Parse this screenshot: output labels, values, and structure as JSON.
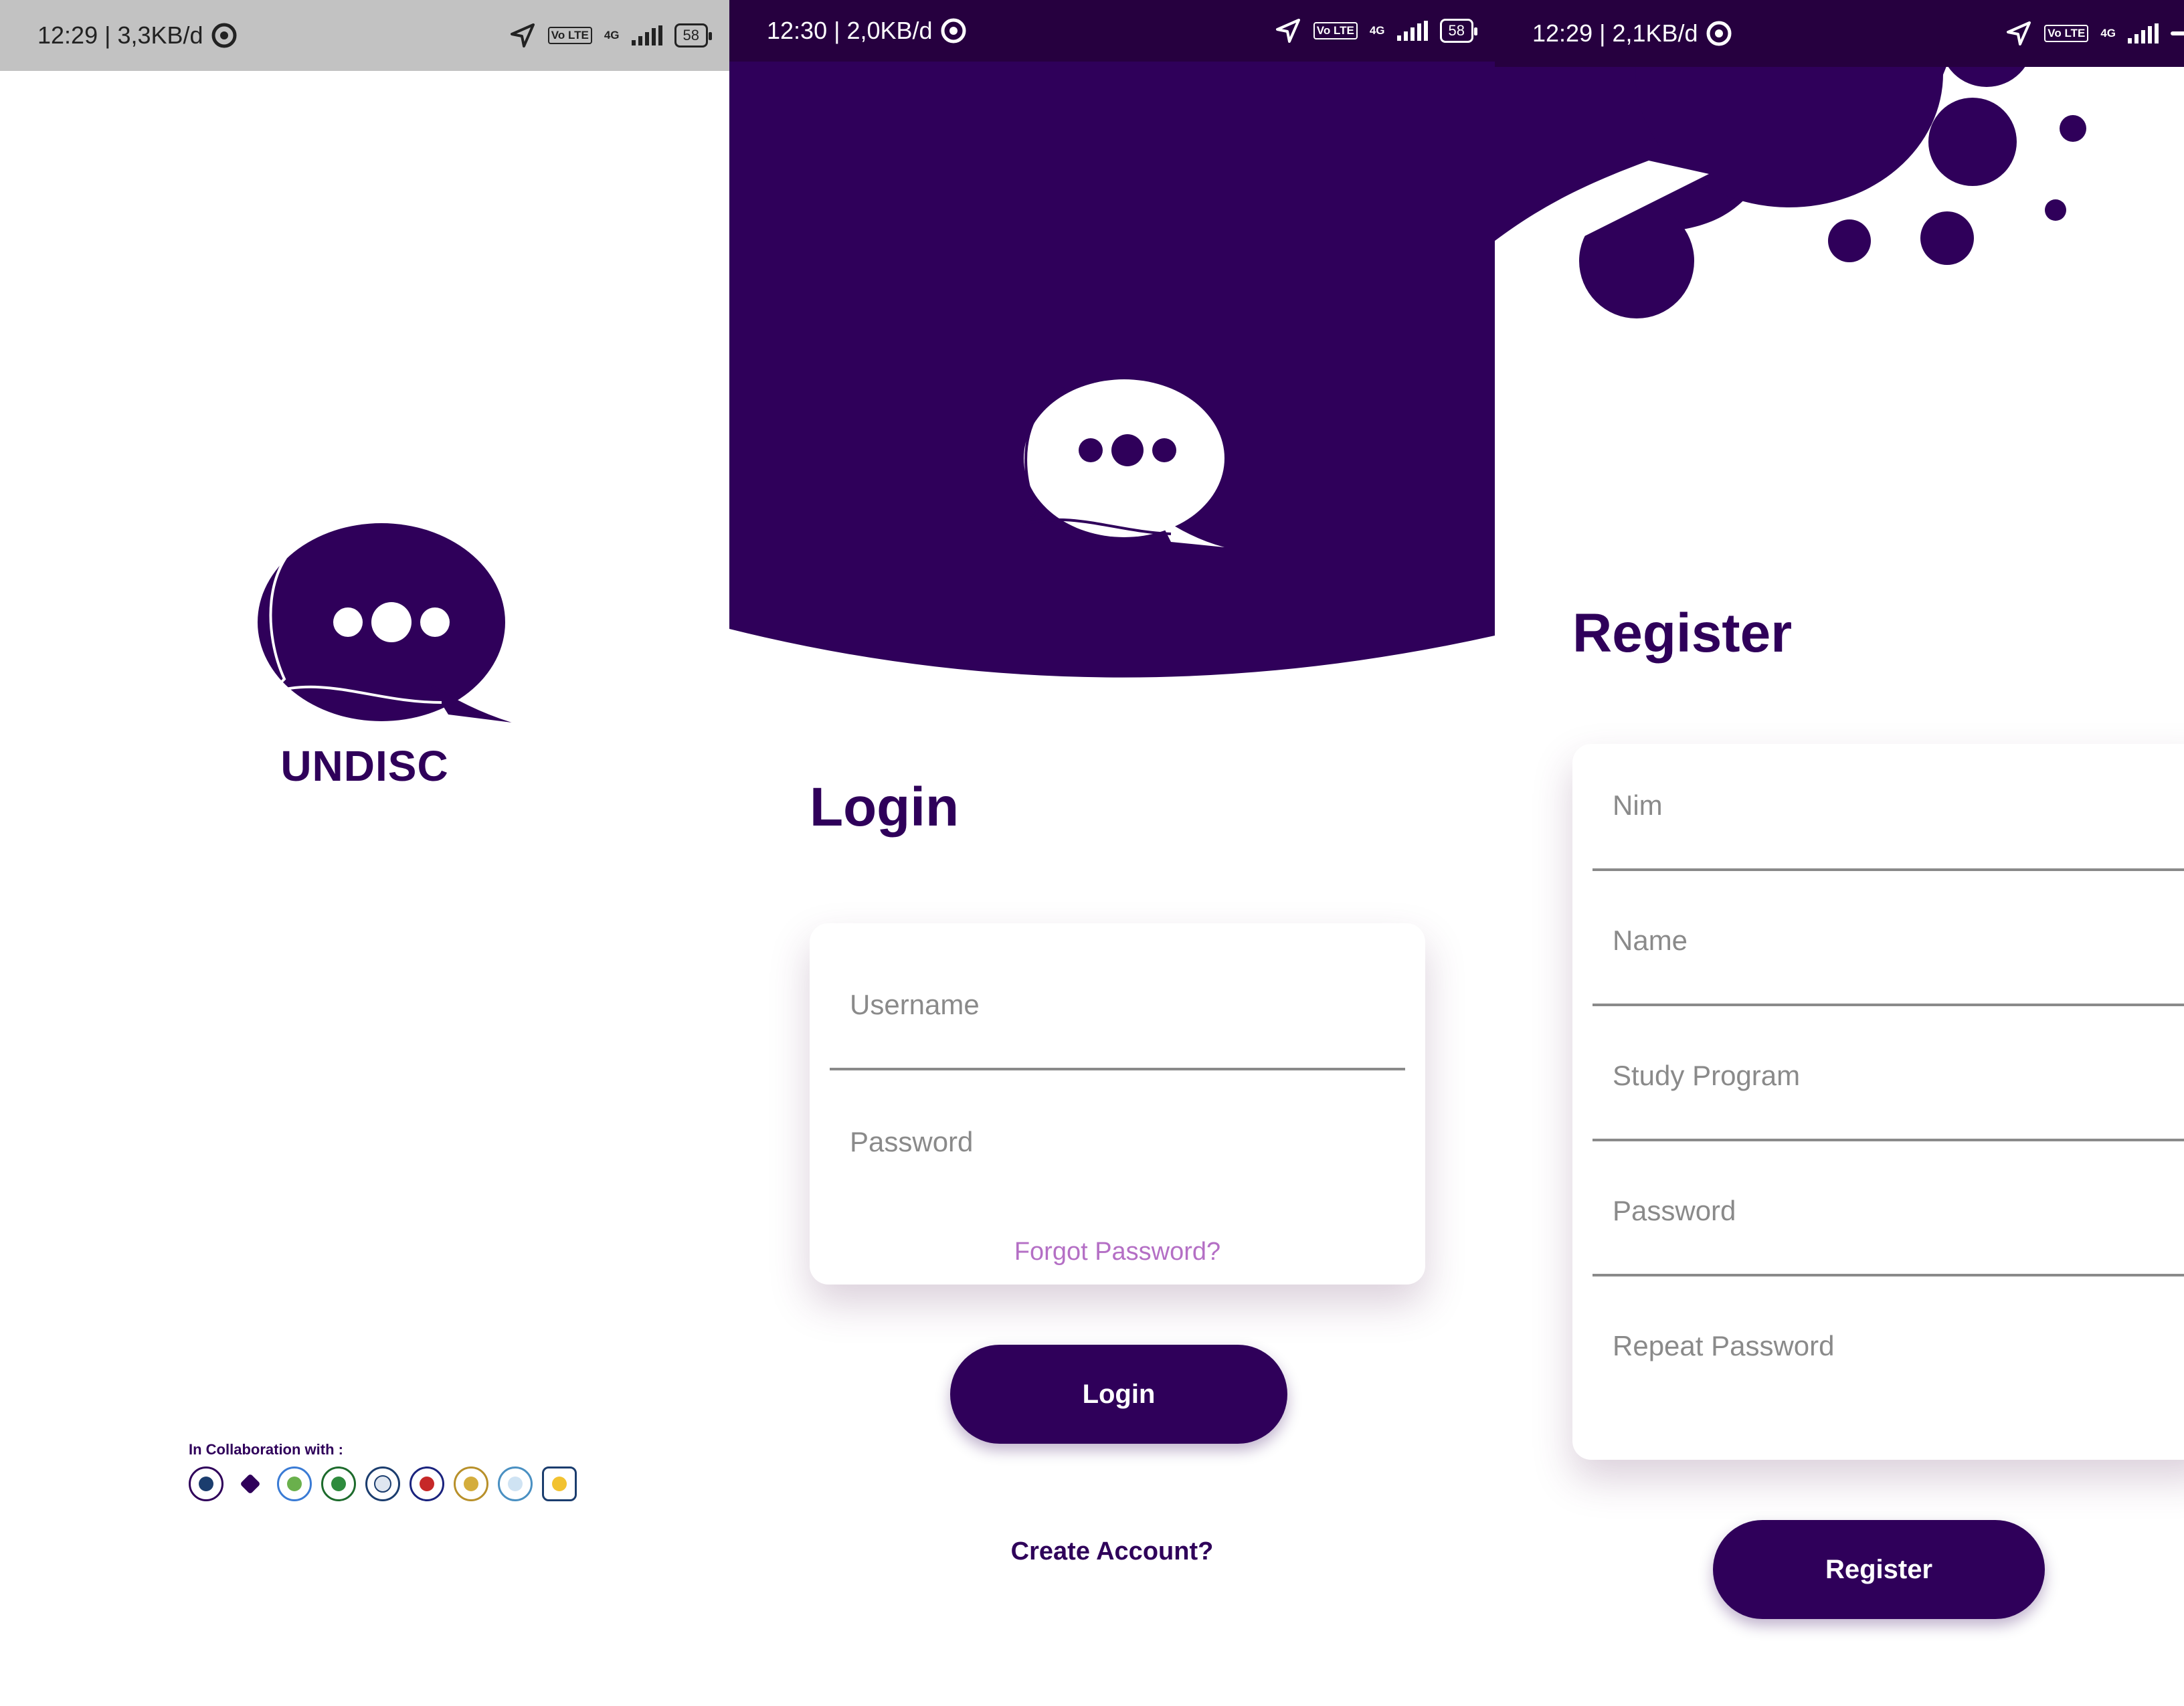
{
  "colors": {
    "primary": "#2f005a",
    "dark_status": "#26003f",
    "link": "#b46fc5",
    "placeholder": "#8a8a8a"
  },
  "splash": {
    "status": {
      "time_info": "12:29 | 3,3KB/d",
      "network": "4G",
      "volte": "Vo LTE",
      "battery": "58"
    },
    "app_name": "UNDISC",
    "collab_label": "In Collaboration with :",
    "partner_logos": [
      "partner-logo-1",
      "partner-logo-2",
      "partner-logo-3",
      "partner-logo-4",
      "partner-logo-5",
      "partner-logo-6",
      "partner-logo-7",
      "partner-logo-8",
      "partner-logo-9"
    ]
  },
  "login": {
    "status": {
      "time_info": "12:30 | 2,0KB/d",
      "network": "4G",
      "volte": "Vo LTE",
      "battery": "58"
    },
    "title": "Login",
    "username_placeholder": "Username",
    "password_placeholder": "Password",
    "forgot_password": "Forgot Password?",
    "login_button": "Login",
    "create_account": "Create Account?"
  },
  "register": {
    "status": {
      "time_info": "12:29 | 2,1KB/d",
      "network": "4G",
      "volte": "Vo LTE"
    },
    "title": "Register",
    "fields": [
      "Nim",
      "Name",
      "Study Program",
      "Password",
      "Repeat Password"
    ],
    "register_button": "Register"
  }
}
